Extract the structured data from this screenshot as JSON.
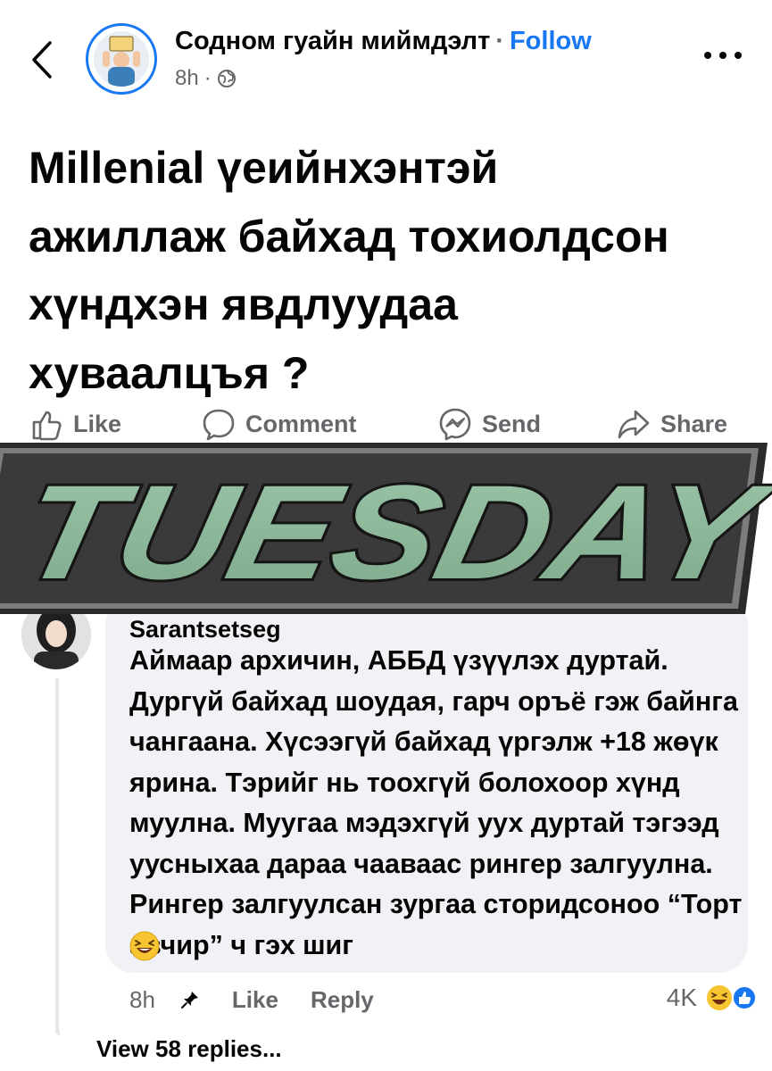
{
  "header": {
    "page_name": "Содном гуайн миймдэлт",
    "separator": "·",
    "follow_label": "Follow",
    "timestamp": "8h",
    "meta_dot": "·",
    "privacy_icon": "globe-icon",
    "more_icon": "more-options-icon",
    "back_icon": "back-chevron-icon"
  },
  "post": {
    "text": "Millenial үеийнхэнтэй ажиллаж байхад тохиолдсон хүндхэн явдлуудаа хуваалцъя ?"
  },
  "actions": [
    {
      "label": "Like",
      "icon": "thumbs-up-icon"
    },
    {
      "label": "Comment",
      "icon": "comment-icon"
    },
    {
      "label": "Send",
      "icon": "messenger-icon"
    },
    {
      "label": "Share",
      "icon": "share-icon"
    }
  ],
  "overlay": {
    "text": "TUESDAY",
    "fill_color": "#8fb89c",
    "stroke_color": "#1c1c1c"
  },
  "comment": {
    "author": "Sarantsetseg",
    "text": "Аймаар архичин, АББД үзүүлэх дуртай. Дургүй байхад шоудая, гарч оръё гэж байнга чангаана. Хүсээгүй байхад үргэлж +18 жөүк ярина. Тэрийг нь тоохгүй болохоор хүнд муулна. Муугаа мэдэхгүй уух дуртай тэгээд уусныхаа дараа чааваас рингер залгуулна. Рингер залгуулсан зургаа сторидсоноо “Торт авчир” ч гэх шиг",
    "emoji": "laughing-face-emoji",
    "time": "8h",
    "pin_icon": "pin-icon",
    "like_label": "Like",
    "reply_label": "Reply",
    "reaction_count": "4K",
    "reaction_icons": [
      "haha-reaction-icon",
      "like-reaction-icon"
    ],
    "view_replies_label": "View 58 replies..."
  },
  "colors": {
    "accent": "#1877f2",
    "secondary_text": "#65676b",
    "bubble": "#f0f2f5"
  }
}
